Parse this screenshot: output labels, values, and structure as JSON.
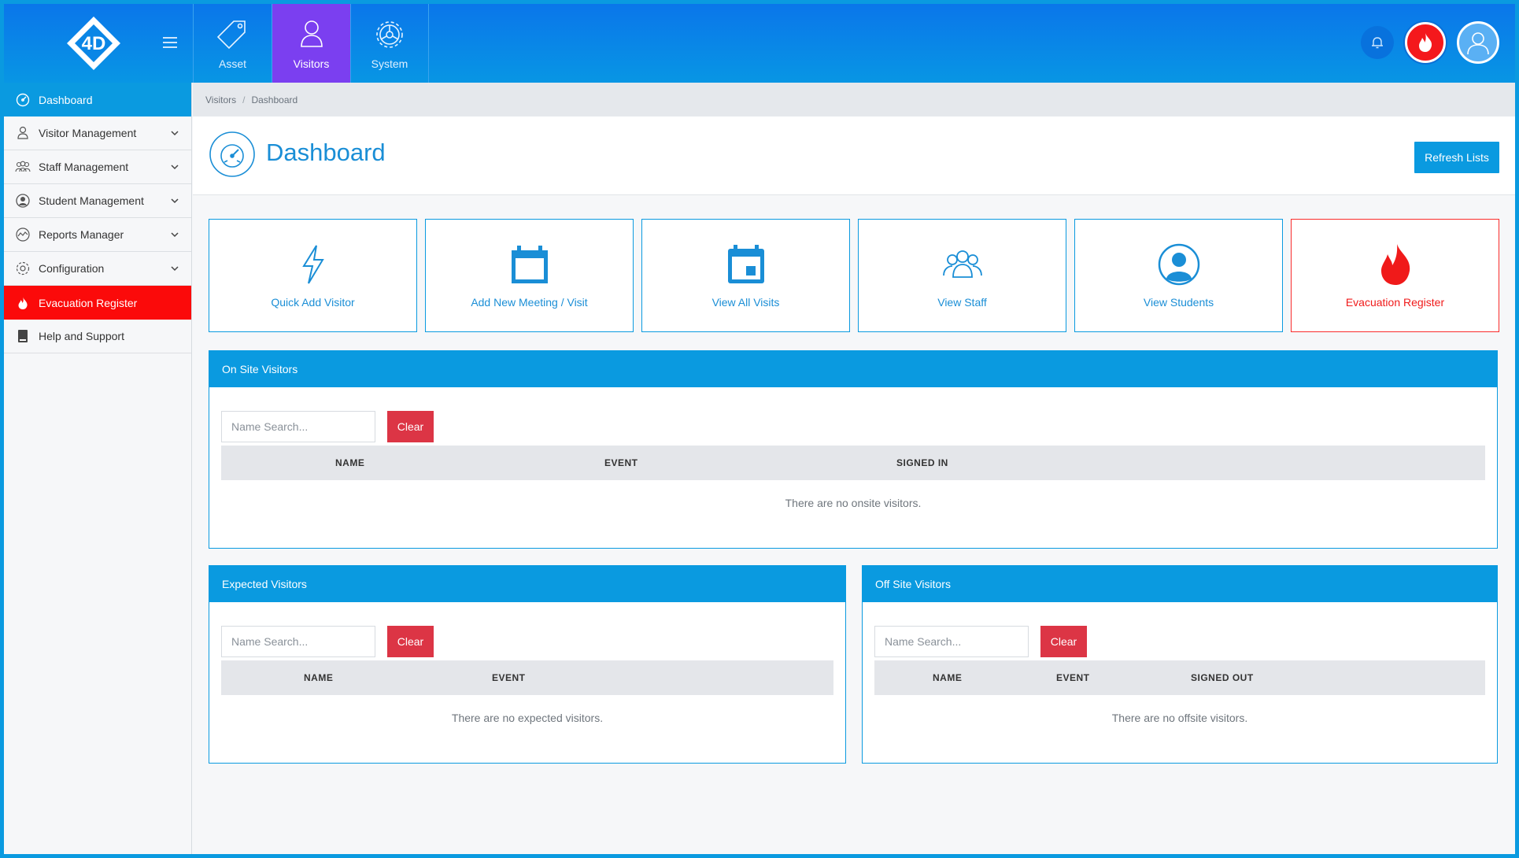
{
  "topbar": {
    "modules": [
      {
        "label": "Asset",
        "icon": "tag-icon"
      },
      {
        "label": "Visitors",
        "icon": "person-icon",
        "active": true
      },
      {
        "label": "System",
        "icon": "gear-icon"
      }
    ]
  },
  "sidebar": {
    "items": [
      {
        "label": "Dashboard",
        "icon": "speedometer-icon"
      },
      {
        "label": "Visitor Management",
        "icon": "visitor-icon"
      },
      {
        "label": "Staff Management",
        "icon": "staff-icon"
      },
      {
        "label": "Student Management",
        "icon": "student-icon"
      },
      {
        "label": "Reports Manager",
        "icon": "chart-icon"
      },
      {
        "label": "Configuration",
        "icon": "gear-icon"
      },
      {
        "label": "Evacuation Register",
        "icon": "fire-icon"
      },
      {
        "label": "Help and Support",
        "icon": "book-icon"
      }
    ]
  },
  "breadcrumb": {
    "part1": "Visitors",
    "separator": "/",
    "part2": "Dashboard"
  },
  "page": {
    "title": "Dashboard",
    "refresh_label": "Refresh Lists"
  },
  "tiles": [
    {
      "label": "Quick Add Visitor",
      "icon": "lightning-icon"
    },
    {
      "label": "Add New Meeting / Visit",
      "icon": "calendar-icon"
    },
    {
      "label": "View All Visits",
      "icon": "calendar-event-icon"
    },
    {
      "label": "View Staff",
      "icon": "group-icon"
    },
    {
      "label": "View Students",
      "icon": "student-avatar-icon"
    },
    {
      "label": "Evacuation Register",
      "icon": "fire-icon"
    }
  ],
  "onsite": {
    "title": "On Site Visitors",
    "search_placeholder": "Name Search...",
    "clear_label": "Clear",
    "columns": [
      "NAME",
      "EVENT",
      "SIGNED IN"
    ],
    "empty": "There are no onsite visitors."
  },
  "expected": {
    "title": "Expected Visitors",
    "search_placeholder": "Name Search...",
    "clear_label": "Clear",
    "columns": [
      "NAME",
      "EVENT"
    ],
    "empty": "There are no expected visitors."
  },
  "offsite": {
    "title": "Off Site Visitors",
    "search_placeholder": "Name Search...",
    "clear_label": "Clear",
    "columns": [
      "NAME",
      "EVENT",
      "SIGNED OUT"
    ],
    "empty": "There are no offsite visitors."
  },
  "colors": {
    "primary": "#0a9ae0",
    "active_module": "#7b3ff0",
    "danger": "#fb0a0a",
    "clear": "#dc3545"
  }
}
